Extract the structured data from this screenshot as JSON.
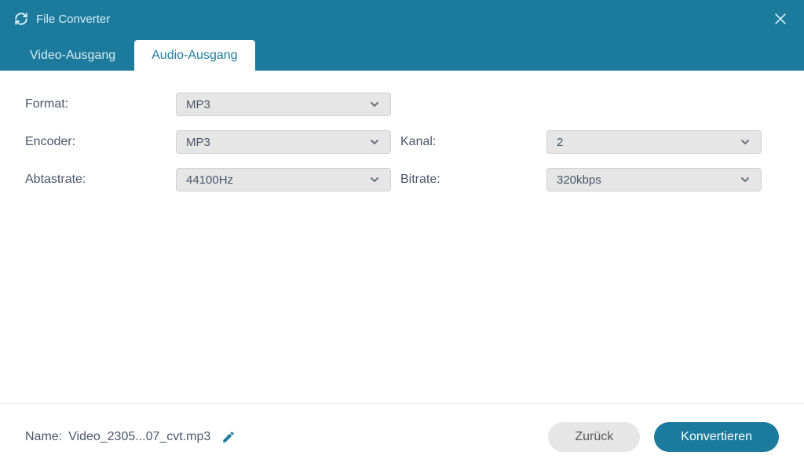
{
  "header": {
    "title": "File Converter"
  },
  "tabs": {
    "video": "Video-Ausgang",
    "audio": "Audio-Ausgang"
  },
  "labels": {
    "format": "Format:",
    "encoder": "Encoder:",
    "channel": "Kanal:",
    "samplerate": "Abtastrate:",
    "bitrate": "Bitrate:",
    "name": "Name:"
  },
  "values": {
    "format": "MP3",
    "encoder": "MP3",
    "channel": "2",
    "samplerate": "44100Hz",
    "bitrate": "320kbps",
    "filename": "Video_2305...07_cvt.mp3"
  },
  "buttons": {
    "back": "Zurück",
    "convert": "Konvertieren"
  }
}
